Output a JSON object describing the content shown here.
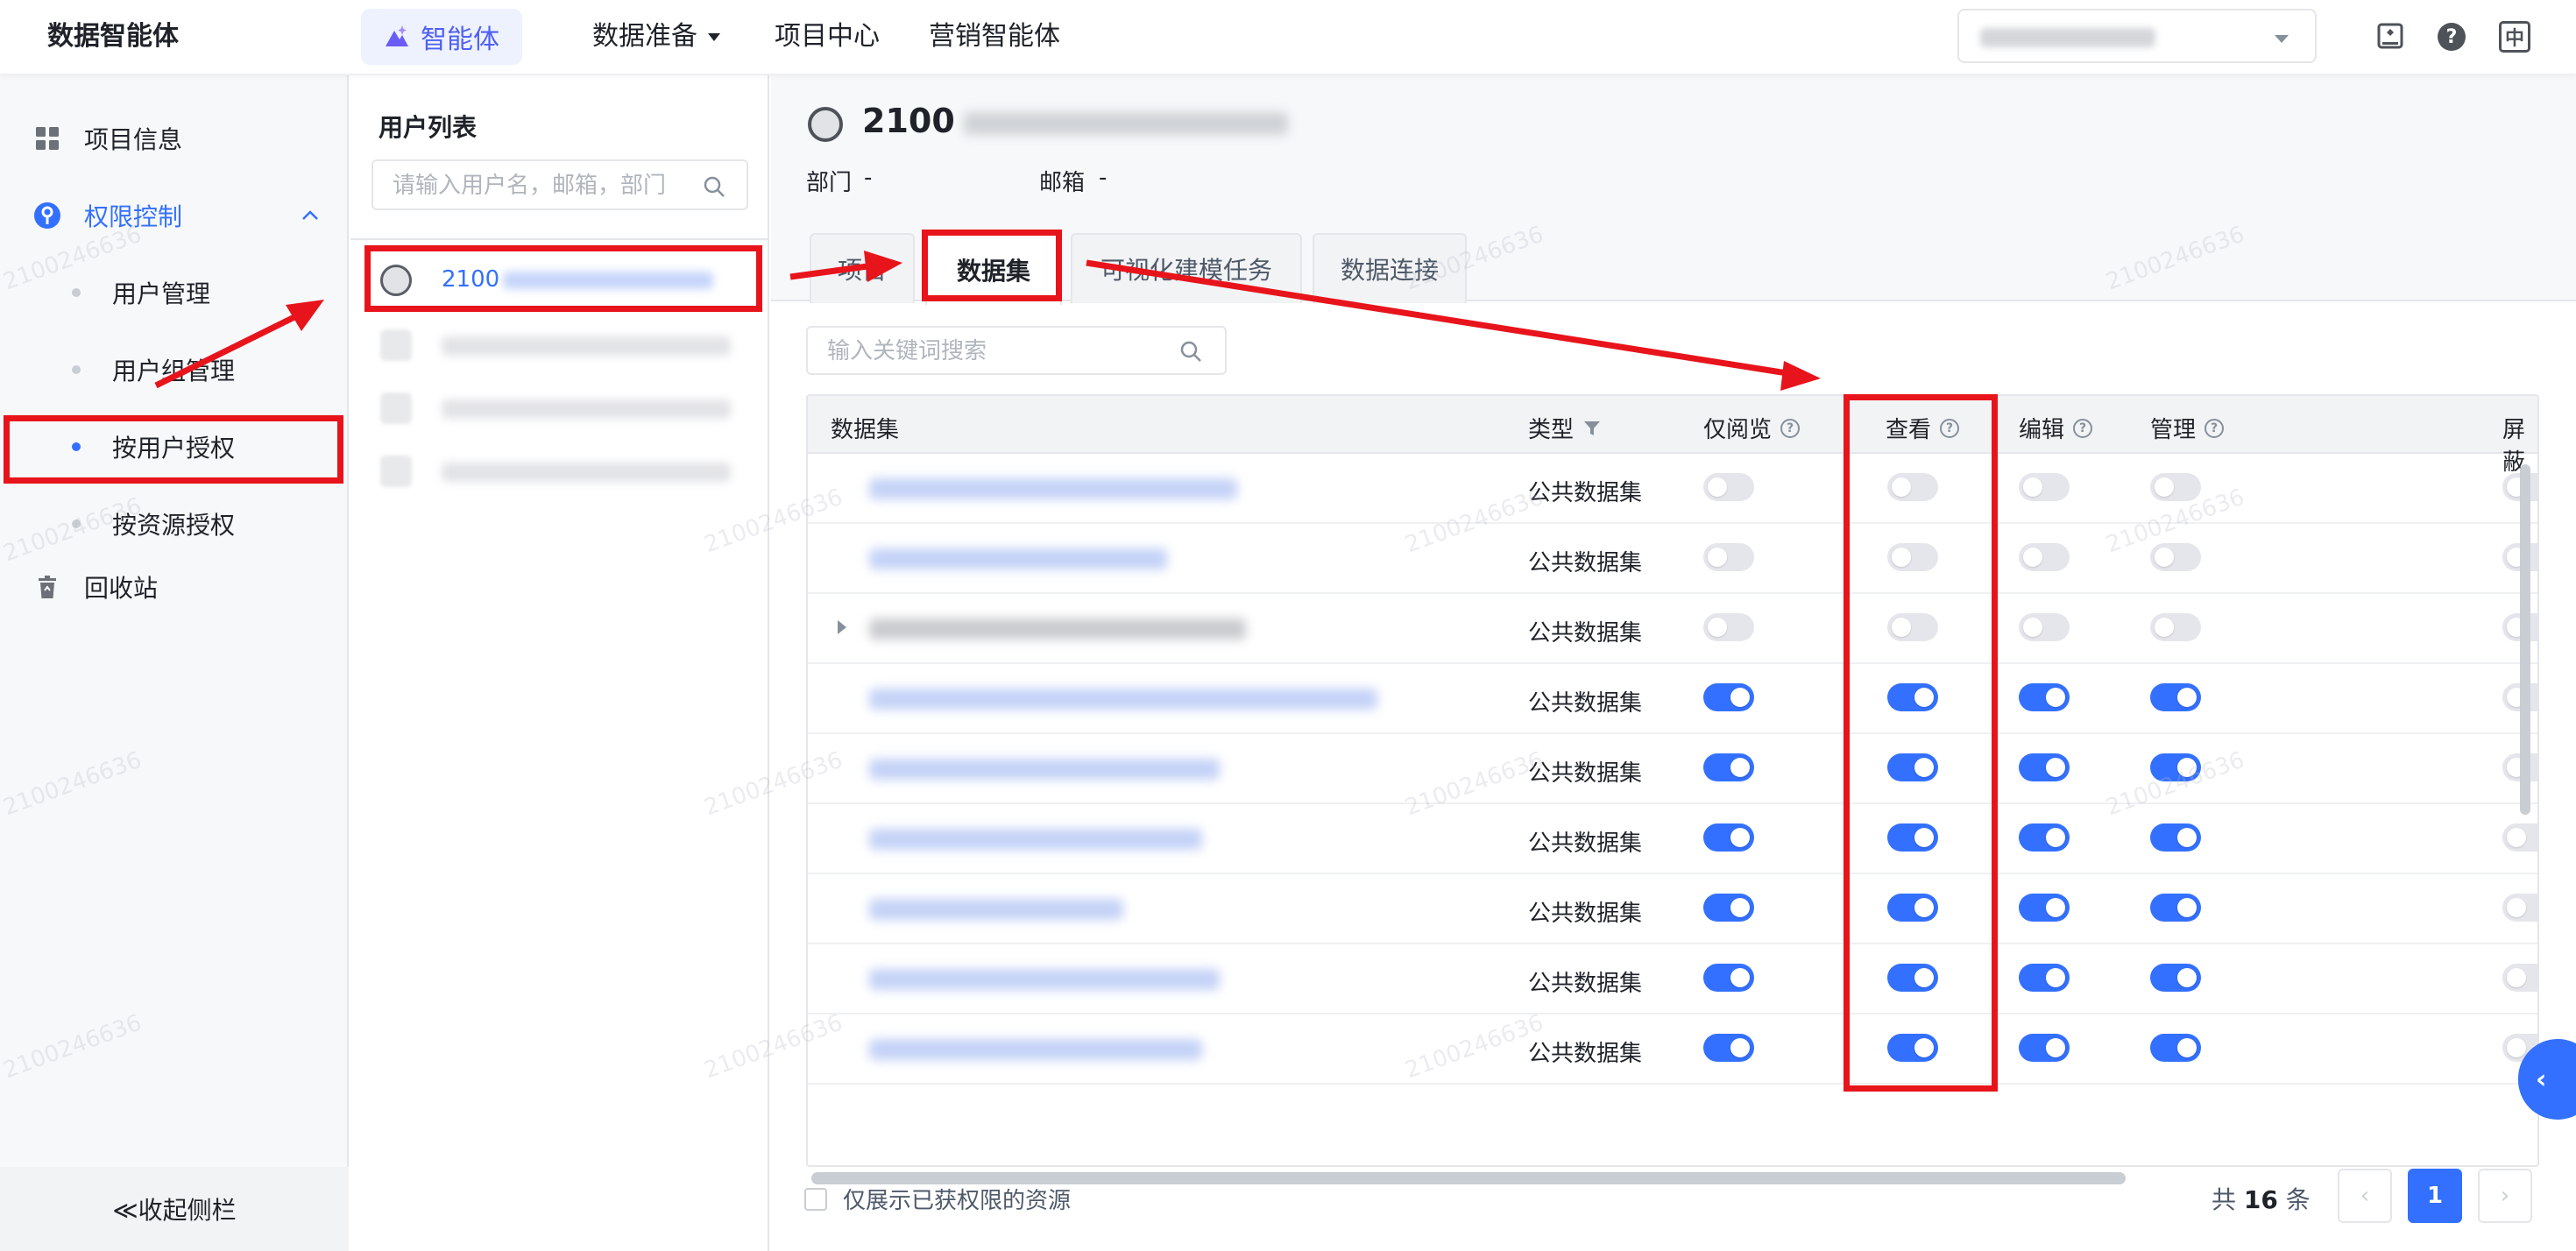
{
  "topbar": {
    "brand": "数据智能体",
    "agent_tab": "智能体",
    "nav": [
      "数据准备",
      "项目中心",
      "营销智能体"
    ],
    "icons": [
      "clipboard-icon",
      "help-icon",
      "language-toggle-icon"
    ],
    "language_glyph": "中"
  },
  "sidebar": {
    "items": [
      {
        "label": "项目信息",
        "icon": "grid-icon"
      },
      {
        "label": "权限控制",
        "icon": "key-icon"
      },
      {
        "label": "用户管理"
      },
      {
        "label": "用户组管理"
      },
      {
        "label": "按用户授权"
      },
      {
        "label": "按资源授权"
      },
      {
        "label": "回收站",
        "icon": "trash-icon"
      }
    ],
    "collapse": "≪收起侧栏"
  },
  "userlist": {
    "title": "用户列表",
    "search_placeholder": "请输入用户名，邮箱，部门",
    "selected_user_prefix": "2100"
  },
  "main": {
    "user_name_prefix": "2100",
    "dept_label": "部门",
    "dept_value": "-",
    "email_label": "邮箱",
    "email_value": "-",
    "tabs": [
      "项目",
      "数据集",
      "可视化建模任务",
      "数据连接"
    ],
    "search_placeholder": "输入关键词搜索",
    "columns": [
      "数据集",
      "类型",
      "仅阅览",
      "查看",
      "编辑",
      "管理",
      "屏蔽"
    ],
    "help_glyph": "?",
    "rows": [
      {
        "type": "公共数据集",
        "browse": false,
        "view": false,
        "edit": false,
        "manage": false,
        "block": false
      },
      {
        "type": "公共数据集",
        "browse": false,
        "view": false,
        "edit": false,
        "manage": false,
        "block": false
      },
      {
        "type": "公共数据集",
        "browse": false,
        "view": false,
        "edit": false,
        "manage": false,
        "block": false
      },
      {
        "type": "公共数据集",
        "browse": true,
        "view": true,
        "edit": true,
        "manage": true,
        "block": false
      },
      {
        "type": "公共数据集",
        "browse": true,
        "view": true,
        "edit": true,
        "manage": true,
        "block": false
      },
      {
        "type": "公共数据集",
        "browse": true,
        "view": true,
        "edit": true,
        "manage": true,
        "block": false
      },
      {
        "type": "公共数据集",
        "browse": true,
        "view": true,
        "edit": true,
        "manage": true,
        "block": false
      },
      {
        "type": "公共数据集",
        "browse": true,
        "view": true,
        "edit": true,
        "manage": true,
        "block": false
      },
      {
        "type": "公共数据集",
        "browse": true,
        "view": true,
        "edit": true,
        "manage": true,
        "block": false
      }
    ],
    "only_granted_label": "仅展示已获权限的资源",
    "total_prefix": "共",
    "total_count": "16",
    "total_suffix": "条",
    "page_current": "1",
    "prev_glyph": "‹",
    "next_glyph": "›",
    "fab_glyph": "‹"
  },
  "watermark": "2100246636",
  "colors": {
    "accent": "#3370ff",
    "annotation_red": "#e8141b",
    "agent_purple": "#4e5ff5"
  }
}
